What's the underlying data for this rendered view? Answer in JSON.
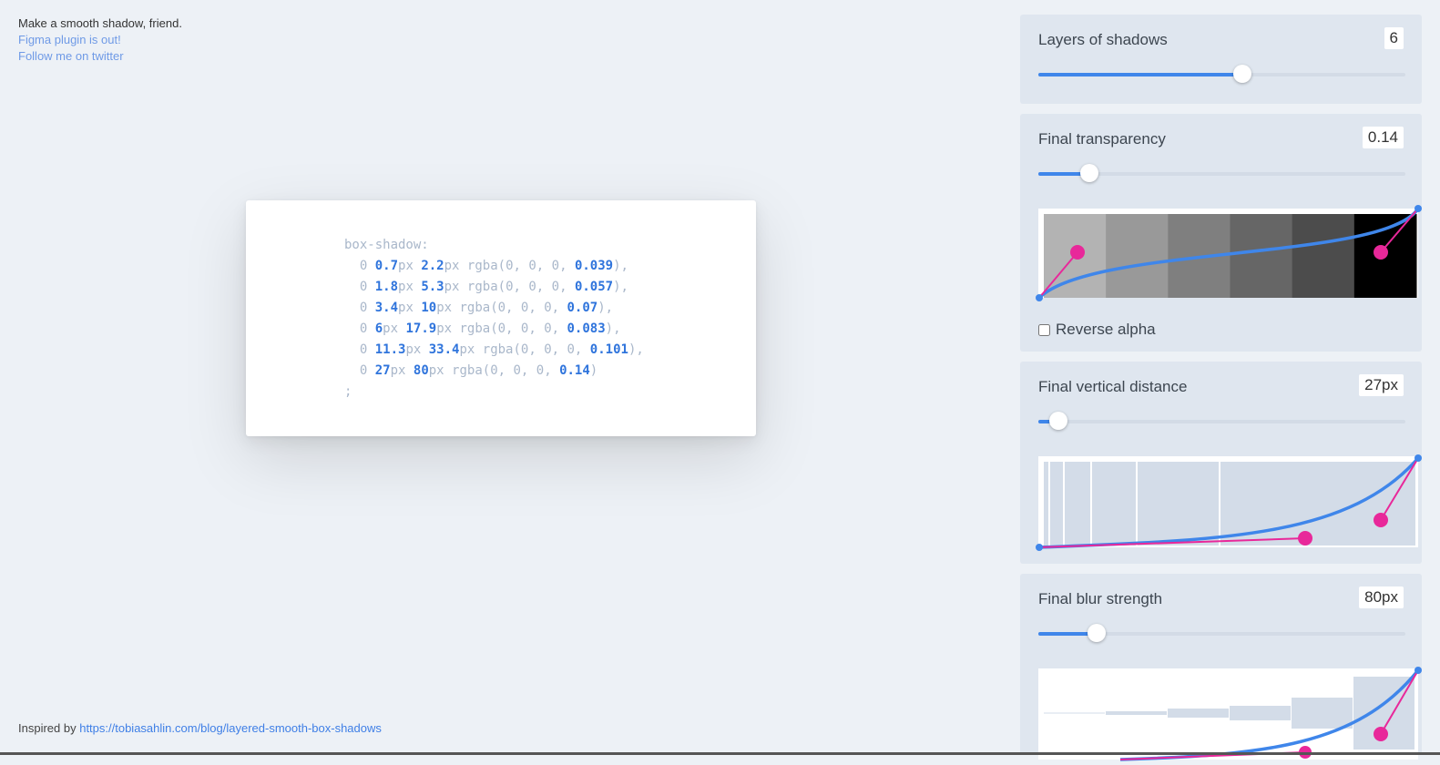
{
  "intro": {
    "tagline": "Make a smooth shadow, friend.",
    "figma_link": "Figma plugin is out!",
    "twitter_link": "Follow me on twitter"
  },
  "footer": {
    "prefix": "Inspired by",
    "link": "https://tobiasahlin.com/blog/layered-smooth-box-shadows"
  },
  "code": {
    "property": "box-shadow:",
    "lines": [
      {
        "x": "0",
        "y": "0.7",
        "blur": "2.2",
        "rgb": "rgba(0, 0, 0, ",
        "alpha": "0.039",
        "end": "),"
      },
      {
        "x": "0",
        "y": "1.8",
        "blur": "5.3",
        "rgb": "rgba(0, 0, 0, ",
        "alpha": "0.057",
        "end": "),"
      },
      {
        "x": "0",
        "y": "3.4",
        "blur": "10",
        "rgb": "rgba(0, 0, 0, ",
        "alpha": "0.07",
        "end": "),"
      },
      {
        "x": "0",
        "y": "6",
        "blur": "17.9",
        "rgb": "rgba(0, 0, 0, ",
        "alpha": "0.083",
        "end": "),"
      },
      {
        "x": "0",
        "y": "11.3",
        "blur": "33.4",
        "rgb": "rgba(0, 0, 0, ",
        "alpha": "0.101",
        "end": "),"
      },
      {
        "x": "0",
        "y": "27",
        "blur": "80",
        "rgb": "rgba(0, 0, 0, ",
        "alpha": "0.14",
        "end": ")"
      }
    ],
    "unit": "px",
    "terminator": ";"
  },
  "controls": {
    "layers": {
      "label": "Layers of shadows",
      "value": "6",
      "fraction": 0.555
    },
    "transparency": {
      "label": "Final transparency",
      "value": "0.14",
      "fraction": 0.14
    },
    "reverse_alpha": {
      "label": "Reverse alpha",
      "checked": false
    },
    "distance": {
      "label": "Final vertical distance",
      "value": "27px",
      "fraction": 0.055
    },
    "blur": {
      "label": "Final blur strength",
      "value": "80px",
      "fraction": 0.16
    }
  },
  "colors": {
    "accent": "#3f86ea",
    "handle": "#e8289a",
    "panel": "#dfe6ef",
    "background": "#edf1f6"
  },
  "alpha_swatches": [
    "#b3b3b3",
    "#999999",
    "#7f7f7f",
    "#666666",
    "#4c4c4c",
    "#000000"
  ]
}
